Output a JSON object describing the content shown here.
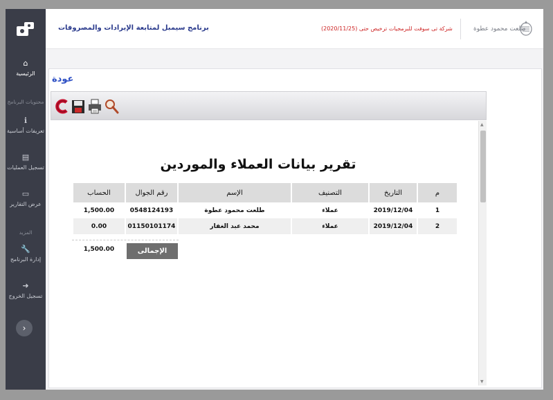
{
  "header": {
    "app_title": "برنامج سيمبل لمتابعة الإيرادات والمصروفات",
    "license_text": "شركة تى سوفت للبرمجيات ترخيص حتى (2020/11/25)",
    "user_name": "طلعت محمود عطوة"
  },
  "sidebar": {
    "home_label": "الرئيسية",
    "section_program_contents": "محتويات البرنامج",
    "basic_definitions_label": "تعريفات أساسية",
    "register_operations_label": "تسجيل العمليات",
    "view_reports_label": "عرض التقارير",
    "section_more": "المزيد",
    "program_admin_label": "إدارة البرنامج",
    "logout_label": "تسجيل الخروج",
    "collapse_icon": "›"
  },
  "page": {
    "back_label": "عودة"
  },
  "toolbar": {
    "icons": [
      "close-icon",
      "save-icon",
      "print-icon",
      "search-icon"
    ]
  },
  "report": {
    "title": "تقرير بيانات العملاء والموردين",
    "columns": [
      "م",
      "التاريخ",
      "التصنيف",
      "الإسم",
      "رقم الجوال",
      "الحساب"
    ],
    "rows": [
      {
        "m": "1",
        "date": "2019/12/04",
        "class": "عملاء",
        "name": "طلعت محمود عطوة",
        "phone": "0548124193",
        "account": "1,500.00"
      },
      {
        "m": "2",
        "date": "2019/12/04",
        "class": "عملاء",
        "name": "محمد عبد الغفار",
        "phone": "01150101174",
        "account": "0.00"
      }
    ],
    "total_label": "الإجمالى",
    "total_value": "1,500.00"
  },
  "colors": {
    "sidebar_bg": "#3a3d48",
    "title_blue": "#2a3a8c",
    "license_red": "#cc1f1f",
    "back_link_blue": "#2d4fc4"
  }
}
